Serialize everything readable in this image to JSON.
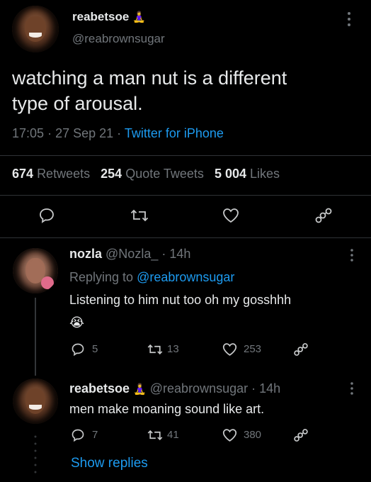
{
  "main_tweet": {
    "display_name": "reabetsoe",
    "name_emoji": "🧘‍♀️",
    "handle": "@reabrownsugar",
    "text_line1": "watching a man nut is a different",
    "text_line2": "type of arousal.",
    "time": "17:05",
    "date": "27 Sep 21",
    "separator": "·",
    "client": "Twitter for iPhone",
    "retweets_count": "674",
    "retweets_label": "Retweets",
    "quotes_count": "254",
    "quotes_label": "Quote Tweets",
    "likes_count": "5 004",
    "likes_label": "Likes"
  },
  "replies": [
    {
      "display_name": "nozla",
      "handle": "@Nozla_",
      "separator": "·",
      "time": "14h",
      "replying_label": "Replying to",
      "replying_handle": "@reabrownsugar",
      "text": "Listening to him nut too oh my gosshhh",
      "emoji": "😭",
      "reply_count": "5",
      "retweet_count": "13",
      "like_count": "253"
    },
    {
      "display_name": "reabetsoe",
      "name_emoji": "🧘‍♀️",
      "handle": "@reabrownsugar",
      "separator": "·",
      "time": "14h",
      "text": "men make moaning sound like art.",
      "reply_count": "7",
      "retweet_count": "41",
      "like_count": "380"
    }
  ],
  "show_replies": "Show replies",
  "colors": {
    "background": "#000000",
    "text": "#e7e9ea",
    "muted": "#71767b",
    "link": "#1d9bf0",
    "divider": "#2f3336"
  }
}
